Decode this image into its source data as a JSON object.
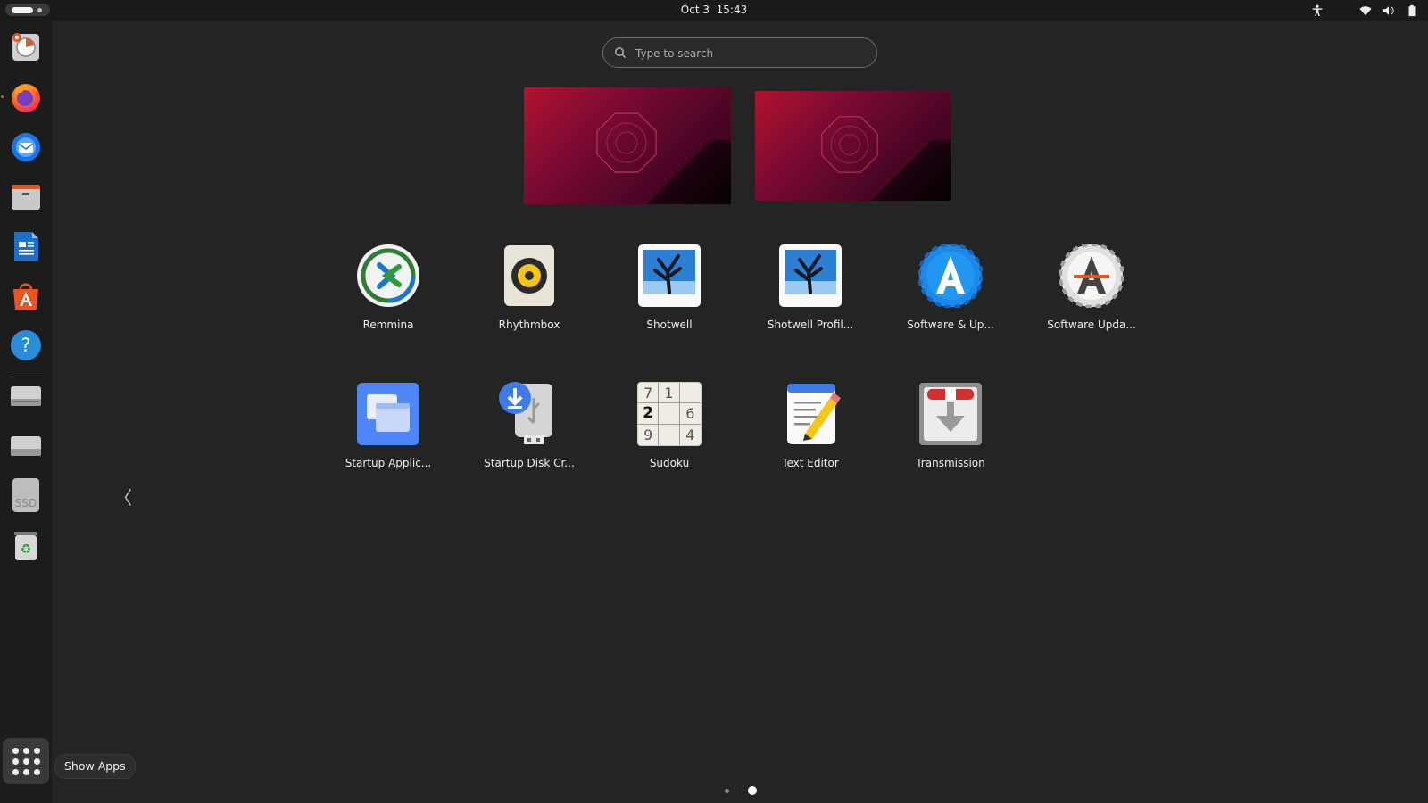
{
  "topbar": {
    "clock_date": "Oct 3",
    "clock_time": "15:43"
  },
  "search": {
    "placeholder": "Type to search",
    "value": ""
  },
  "dock": {
    "items": [
      {
        "name": "Disk Usage Analyzer",
        "icon": "disk-usage-icon"
      },
      {
        "name": "Firefox",
        "icon": "firefox-icon"
      },
      {
        "name": "Thunderbird",
        "icon": "thunderbird-icon"
      },
      {
        "name": "Files",
        "icon": "files-icon"
      },
      {
        "name": "LibreOffice Writer",
        "icon": "writer-icon"
      },
      {
        "name": "App Center",
        "icon": "app-center-icon"
      },
      {
        "name": "Help",
        "icon": "help-icon"
      },
      {
        "name": "Drive 1",
        "icon": "drive-icon"
      },
      {
        "name": "Drive 2",
        "icon": "drive-icon"
      },
      {
        "name": "SSD",
        "icon": "ssd-icon"
      },
      {
        "name": "Trash",
        "icon": "trash-icon"
      }
    ],
    "ssd_text": "SSD",
    "show_apps_tooltip": "Show Apps"
  },
  "apps": [
    {
      "label": "Remmina",
      "icon": "remmina-icon"
    },
    {
      "label": "Rhythmbox",
      "icon": "rhythmbox-icon"
    },
    {
      "label": "Shotwell",
      "icon": "shotwell-icon"
    },
    {
      "label": "Shotwell Profil...",
      "icon": "shotwell-icon"
    },
    {
      "label": "Software & Up...",
      "icon": "software-updates-icon"
    },
    {
      "label": "Software Upda...",
      "icon": "software-updater-icon"
    },
    {
      "label": "Startup Applic...",
      "icon": "startup-apps-icon"
    },
    {
      "label": "Startup Disk Cr...",
      "icon": "startup-disk-icon"
    },
    {
      "label": "Sudoku",
      "icon": "sudoku-icon"
    },
    {
      "label": "Text Editor",
      "icon": "text-editor-icon"
    },
    {
      "label": "Transmission",
      "icon": "transmission-icon"
    }
  ],
  "sudoku_digits": [
    "7",
    "1",
    "",
    "2",
    "",
    "6",
    "9",
    "",
    "4"
  ],
  "pager": {
    "current_page": 2,
    "total_pages": 2
  },
  "colors": {
    "accent": "#e95420",
    "background": "#242424",
    "dock": "#1c1c1c",
    "topbar": "#1a1a1a"
  }
}
